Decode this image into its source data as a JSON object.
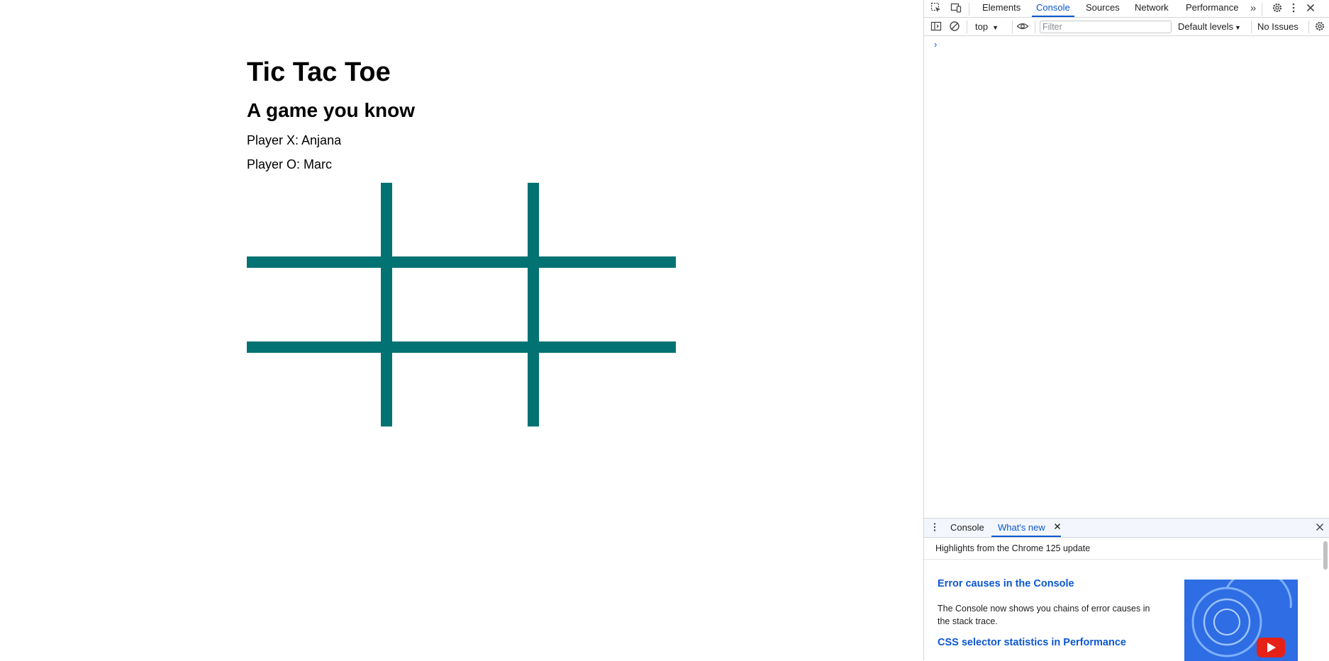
{
  "page": {
    "title": "Tic Tac Toe",
    "subtitle": "A game you know",
    "player_x": "Player X: Anjana",
    "player_o": "Player O: Marc",
    "board_color": "#027273",
    "cells": [
      "",
      "",
      "",
      "",
      "",
      "",
      "",
      "",
      ""
    ]
  },
  "devtools": {
    "tabs": [
      "Elements",
      "Console",
      "Sources",
      "Network",
      "Performance"
    ],
    "active_tab": "Console",
    "toolbar": {
      "context": "top",
      "filter_placeholder": "Filter",
      "levels": "Default levels",
      "issues": "No Issues"
    },
    "console_prompt": "›",
    "accent_color": "#0b57d0",
    "drawer": {
      "tabs": [
        "Console",
        "What's new"
      ],
      "active_tab": "What's new",
      "highlights": "Highlights from the Chrome 125 update",
      "items": [
        {
          "title": "Error causes in the Console",
          "description": "The Console now shows you chains of error causes in the stack trace."
        },
        {
          "title": "CSS selector statistics in Performance"
        }
      ]
    }
  }
}
